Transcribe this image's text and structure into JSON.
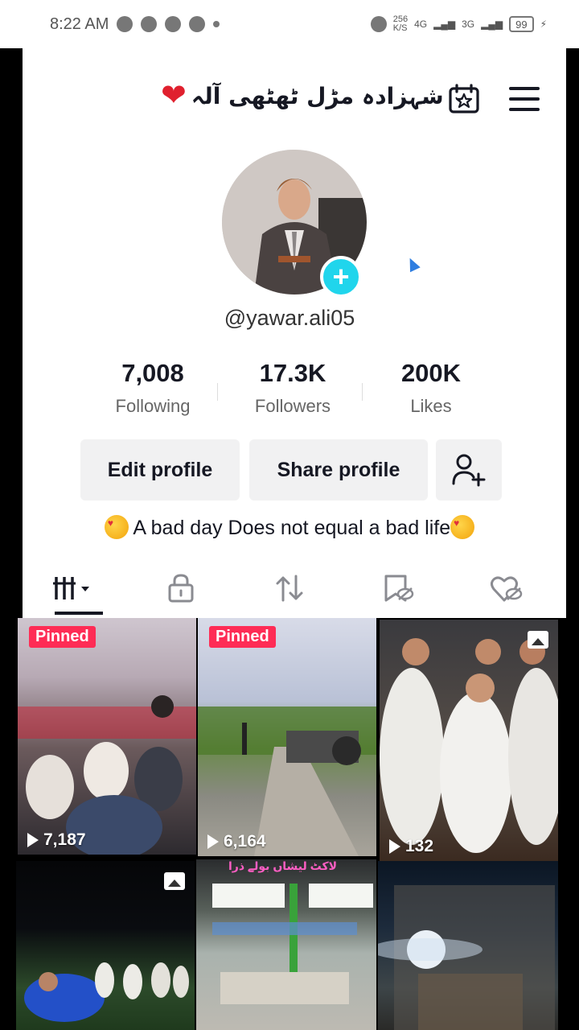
{
  "status_bar": {
    "time": "8:22 AM",
    "network_speed": "256\nK/S",
    "network_1": "4G",
    "network_2": "3G",
    "battery": "99"
  },
  "header": {
    "display_name": "شہزادہ مڑل ٹھٹھی آلہ",
    "heart_icon": "heart-emoji",
    "chevron_icon": "chevron-down-icon",
    "calendar_icon": "calendar-star-icon",
    "menu_icon": "hamburger-menu-icon"
  },
  "profile": {
    "handle": "@yawar.ali05",
    "add_icon": "plus-icon"
  },
  "stats": [
    {
      "value": "7,008",
      "label": "Following"
    },
    {
      "value": "17.3K",
      "label": "Followers"
    },
    {
      "value": "200K",
      "label": "Likes"
    }
  ],
  "actions": {
    "edit_profile": "Edit profile",
    "share_profile": "Share profile",
    "add_friend_icon": "add-user-icon"
  },
  "bio": "A bad day Does not equal a bad life",
  "tabs": [
    {
      "icon": "grid-videos-icon",
      "active": true
    },
    {
      "icon": "lock-icon",
      "active": false
    },
    {
      "icon": "repost-icon",
      "active": false
    },
    {
      "icon": "favorites-hidden-icon",
      "active": false
    },
    {
      "icon": "liked-hidden-icon",
      "active": false
    }
  ],
  "videos": [
    {
      "pinned_label": "Pinned",
      "views": "7,187"
    },
    {
      "pinned_label": "Pinned",
      "views": "6,164"
    },
    {
      "pinned_label": "",
      "views": "132",
      "type": "photo"
    },
    {
      "pinned_label": "",
      "views": "",
      "type": "photo"
    },
    {
      "pinned_label": "",
      "views": "",
      "caption": "لاکٹ لیشاں بولے ذرا"
    },
    {
      "pinned_label": "",
      "views": ""
    }
  ],
  "colors": {
    "accent": "#fe2c55",
    "avatar_add": "#20d5ec",
    "text": "#161823"
  }
}
